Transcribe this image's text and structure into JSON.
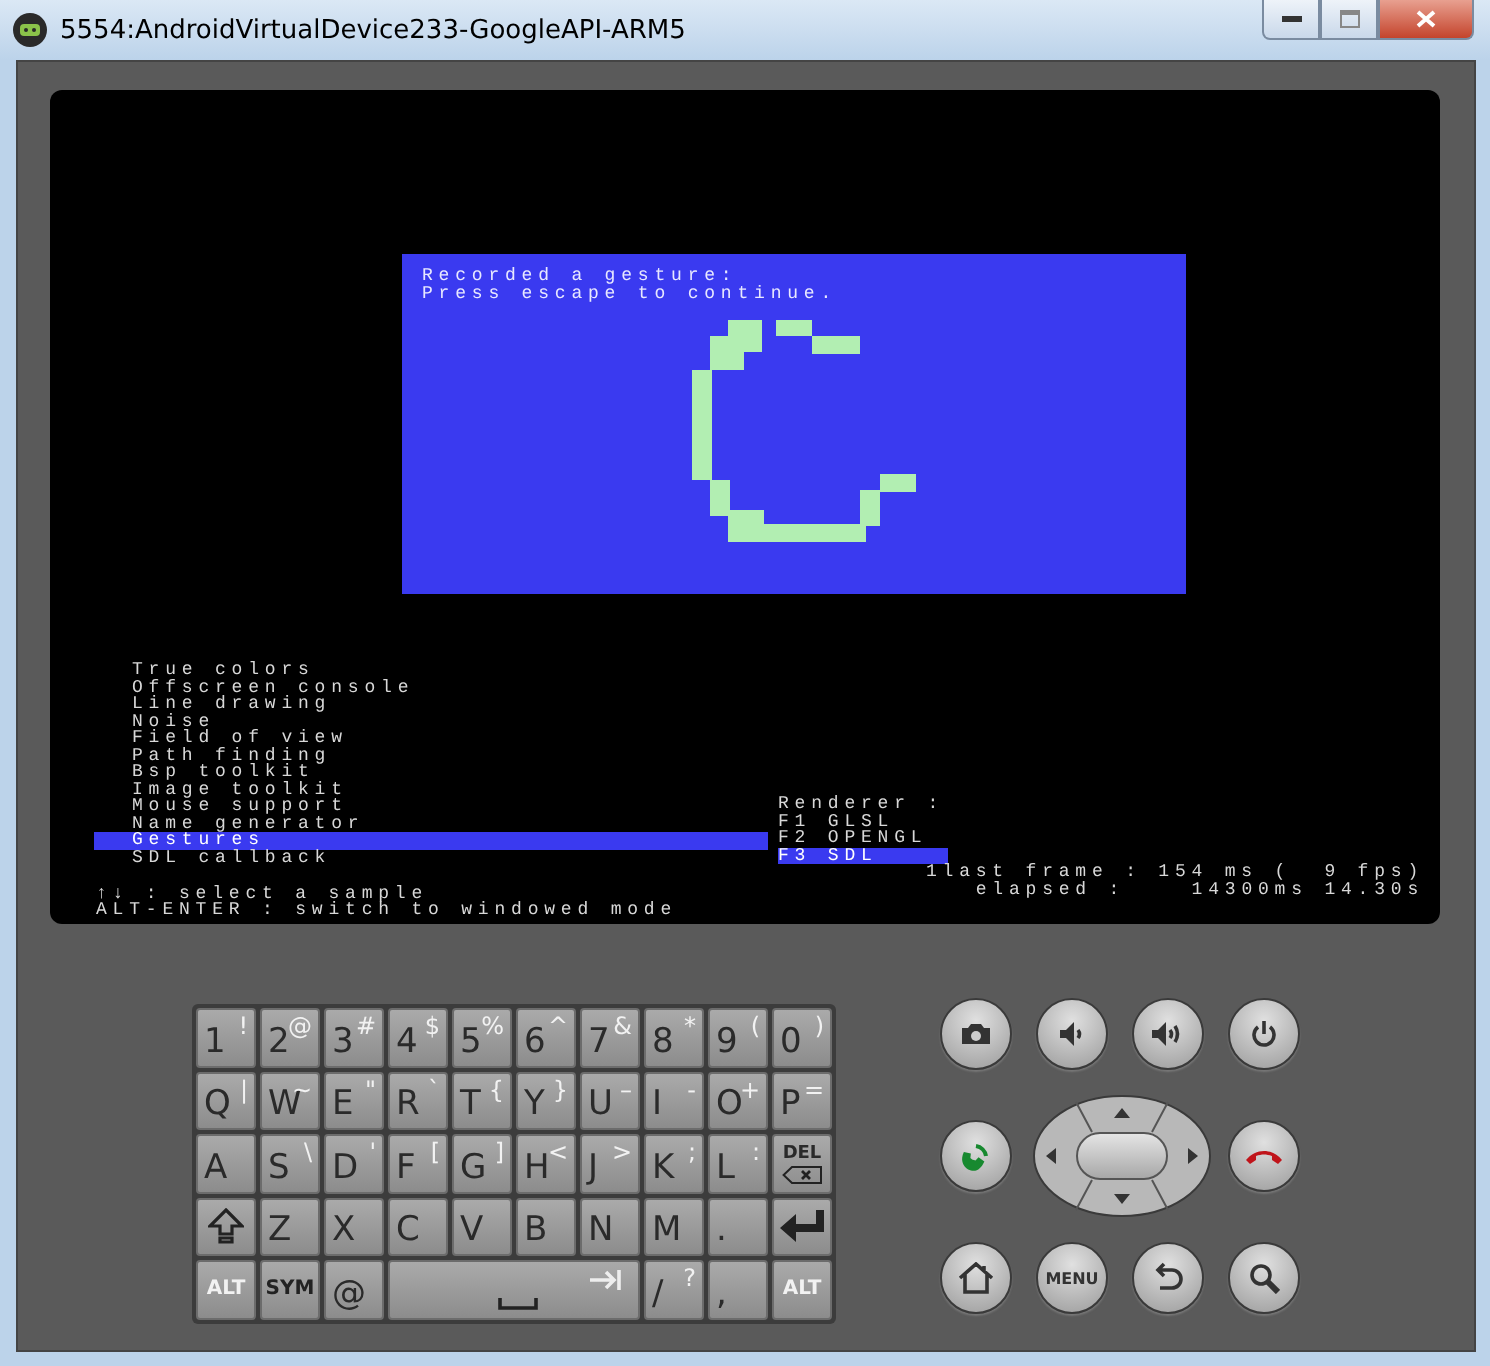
{
  "window": {
    "title": "5554:AndroidVirtualDevice233-GoogleAPI-ARM5"
  },
  "screen": {
    "dialog": {
      "lines": [
        "Recorded a gesture:",
        "Press escape to continue."
      ]
    },
    "samples": [
      {
        "label": "True colors",
        "selected": false
      },
      {
        "label": "Offscreen console",
        "selected": false
      },
      {
        "label": "Line drawing",
        "selected": false
      },
      {
        "label": "Noise",
        "selected": false
      },
      {
        "label": "Field of view",
        "selected": false
      },
      {
        "label": "Path finding",
        "selected": false
      },
      {
        "label": "Bsp toolkit",
        "selected": false
      },
      {
        "label": "Image toolkit",
        "selected": false
      },
      {
        "label": "Mouse support",
        "selected": false
      },
      {
        "label": "Name generator",
        "selected": false
      },
      {
        "label": "Gestures",
        "selected": true
      },
      {
        "label": "SDL callback",
        "selected": false
      }
    ],
    "hints": [
      "↑↓ : select a sample",
      "ALT-ENTER : switch to windowed mode"
    ],
    "renderer": {
      "heading": "Renderer :",
      "options": [
        {
          "label": "F1 GLSL",
          "selected": false
        },
        {
          "label": "F2 OPENGL",
          "selected": false
        },
        {
          "label": "F3 SDL",
          "selected": true
        }
      ]
    },
    "stats": [
      "1last frame : 154 ms (  9 fps)",
      "elapsed :    14300ms 14.30s"
    ]
  },
  "keyboard": {
    "key_lines": [
      {
        "keys": [
          {
            "kind": "char",
            "label": "1",
            "alt": "!"
          },
          {
            "kind": "char",
            "label": "2",
            "alt": "@"
          },
          {
            "kind": "char",
            "label": "3",
            "alt": "#"
          },
          {
            "kind": "char",
            "label": "4",
            "alt": "$"
          },
          {
            "kind": "char",
            "label": "5",
            "alt": "%"
          },
          {
            "kind": "char",
            "label": "6",
            "alt": "^"
          },
          {
            "kind": "char",
            "label": "7",
            "alt": "&"
          },
          {
            "kind": "char",
            "label": "8",
            "alt": "*"
          },
          {
            "kind": "char",
            "label": "9",
            "alt": "("
          },
          {
            "kind": "char",
            "label": "0",
            "alt": ")"
          }
        ]
      },
      {
        "keys": [
          {
            "kind": "char",
            "label": "Q",
            "alt": "|"
          },
          {
            "kind": "char",
            "label": "W",
            "alt": "~"
          },
          {
            "kind": "char",
            "label": "E",
            "alt": "\""
          },
          {
            "kind": "char",
            "label": "R",
            "alt": "`"
          },
          {
            "kind": "char",
            "label": "T",
            "alt": "{"
          },
          {
            "kind": "char",
            "label": "Y",
            "alt": "}"
          },
          {
            "kind": "char",
            "label": "U",
            "alt": "–"
          },
          {
            "kind": "char",
            "label": "I",
            "alt": "-"
          },
          {
            "kind": "char",
            "label": "O",
            "alt": "+"
          },
          {
            "kind": "char",
            "label": "P",
            "alt": "="
          }
        ]
      },
      {
        "keys": [
          {
            "kind": "char",
            "label": "A"
          },
          {
            "kind": "char",
            "label": "S",
            "alt": "\\"
          },
          {
            "kind": "char",
            "label": "D",
            "alt": "'"
          },
          {
            "kind": "char",
            "label": "F",
            "alt": "["
          },
          {
            "kind": "char",
            "label": "G",
            "alt": "]"
          },
          {
            "kind": "char",
            "label": "H",
            "alt": "<"
          },
          {
            "kind": "char",
            "label": "J",
            "alt": ">"
          },
          {
            "kind": "char",
            "label": "K",
            "alt": ";"
          },
          {
            "kind": "char",
            "label": "L",
            "alt": ":"
          },
          {
            "kind": "delete",
            "label": "DEL"
          }
        ]
      },
      {
        "keys": [
          {
            "kind": "shift"
          },
          {
            "kind": "char",
            "label": "Z"
          },
          {
            "kind": "char",
            "label": "X"
          },
          {
            "kind": "char",
            "label": "C"
          },
          {
            "kind": "char",
            "label": "V"
          },
          {
            "kind": "char",
            "label": "B"
          },
          {
            "kind": "char",
            "label": "N"
          },
          {
            "kind": "char",
            "label": "M"
          },
          {
            "kind": "char",
            "label": "."
          },
          {
            "kind": "enter"
          }
        ]
      },
      {
        "keys": [
          {
            "kind": "modifier",
            "label": "ALT"
          },
          {
            "kind": "modifier",
            "label": "SYM"
          },
          {
            "kind": "char",
            "label": "@"
          },
          {
            "kind": "space"
          },
          {
            "kind": "char",
            "label": "/",
            "alt": "?"
          },
          {
            "kind": "char",
            "label": ","
          },
          {
            "kind": "modifier",
            "label": "ALT"
          }
        ]
      }
    ]
  },
  "hardware_buttons": {
    "menu_label": "MENU"
  }
}
